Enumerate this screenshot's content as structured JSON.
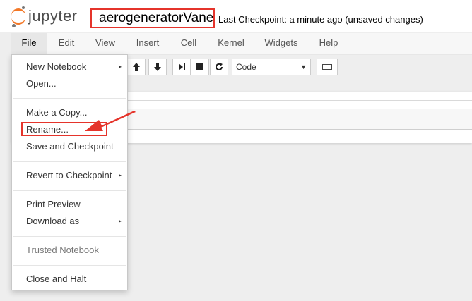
{
  "header": {
    "logo_text": "jupyter",
    "notebook_name": "aerogeneratorVane",
    "checkpoint_text": "Last Checkpoint: a minute ago (unsaved changes)"
  },
  "menubar": {
    "items": [
      {
        "label": "File"
      },
      {
        "label": "Edit"
      },
      {
        "label": "View"
      },
      {
        "label": "Insert"
      },
      {
        "label": "Cell"
      },
      {
        "label": "Kernel"
      },
      {
        "label": "Widgets"
      },
      {
        "label": "Help"
      }
    ]
  },
  "toolbar": {
    "buttons": [
      {
        "icon": "arrow-up-icon",
        "glyph": "🡅"
      },
      {
        "icon": "arrow-down-icon",
        "glyph": "🡇"
      },
      {
        "icon": "step-forward-icon",
        "glyph": "▶|"
      },
      {
        "icon": "stop-icon",
        "glyph": "■"
      },
      {
        "icon": "refresh-icon",
        "glyph": "↻"
      }
    ],
    "cell_type": "Code",
    "keyboard_icon": "keyboard-icon"
  },
  "file_menu": {
    "items": [
      {
        "label": "New Notebook",
        "submenu": "▸"
      },
      {
        "label": "Open..."
      },
      {
        "label": "Make a Copy..."
      },
      {
        "label": "Rename..."
      },
      {
        "label": "Save and Checkpoint"
      },
      {
        "label": "Revert to Checkpoint",
        "submenu": "▸"
      },
      {
        "label": "Print Preview"
      },
      {
        "label": "Download as",
        "submenu": "▸"
      },
      {
        "label": "Trusted Notebook"
      },
      {
        "label": "Close and Halt"
      }
    ]
  },
  "colors": {
    "accent_orange": "#f37726",
    "annotation_red": "#e5342b"
  }
}
